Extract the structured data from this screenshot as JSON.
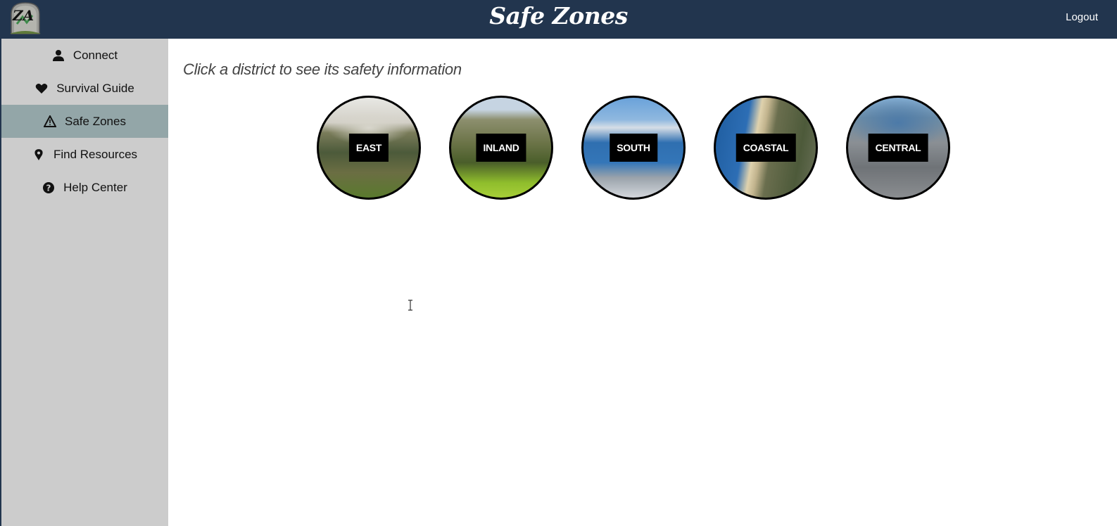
{
  "header": {
    "logo_text": "ZA",
    "title": "Safe Zones",
    "logout_label": "Logout"
  },
  "sidebar": {
    "items": [
      {
        "label": "Connect",
        "icon": "user-icon",
        "active": false
      },
      {
        "label": "Survival Guide",
        "icon": "heart-icon",
        "active": false
      },
      {
        "label": "Safe Zones",
        "icon": "warning-icon",
        "active": true
      },
      {
        "label": "Find Resources",
        "icon": "map-pin-icon",
        "active": false
      },
      {
        "label": "Help Center",
        "icon": "question-circle-icon",
        "active": false
      }
    ]
  },
  "main": {
    "instruction": "Click a district to see its safety information",
    "districts": [
      {
        "label": "EAST"
      },
      {
        "label": "INLAND"
      },
      {
        "label": "SOUTH"
      },
      {
        "label": "COASTAL"
      },
      {
        "label": "CENTRAL"
      }
    ]
  },
  "colors": {
    "header_bg": "#22354e",
    "sidebar_bg": "#cccccc",
    "sidebar_active_bg": "#93a6a8",
    "label_bg": "#000000",
    "label_text": "#ffffff"
  }
}
